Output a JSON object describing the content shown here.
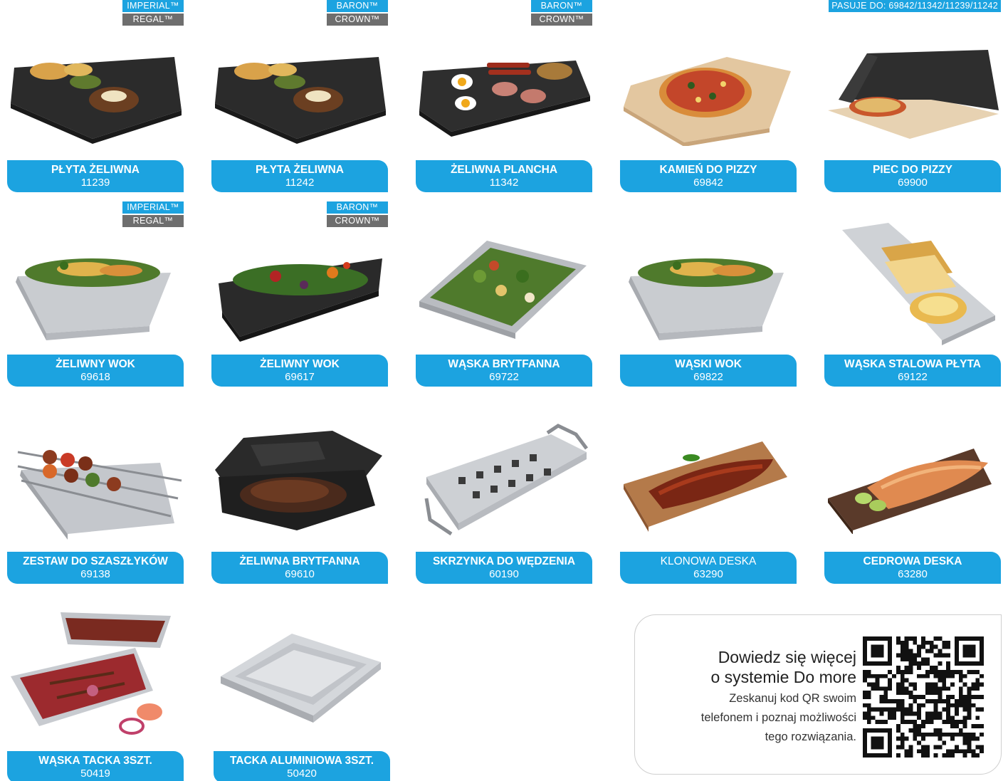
{
  "row1": [
    {
      "badges": [
        "IMPERIAL™",
        "REGAL™"
      ],
      "name": "PŁYTA ŻELIWNA",
      "code": "11239",
      "icon": "cast-iron-griddle-image"
    },
    {
      "badges": [
        "BARON™",
        "CROWN™"
      ],
      "name": "PŁYTA ŻELIWNA",
      "code": "11242",
      "icon": "cast-iron-griddle-image"
    },
    {
      "badges": [
        "BARON™",
        "CROWN™"
      ],
      "name": "ŻELIWNA PLANCHA",
      "code": "11342",
      "icon": "plancha-image"
    },
    {
      "badges": [],
      "name": "KAMIEŃ DO PIZZY",
      "code": "69842",
      "icon": "pizza-stone-image"
    },
    {
      "badges": [
        "PASUJE DO: 69842/11342/11239/11242"
      ],
      "name": "PIEC DO PIZZY",
      "code": "69900",
      "icon": "pizza-oven-image"
    }
  ],
  "row2": [
    {
      "badges": [
        "IMPERIAL™",
        "REGAL™"
      ],
      "name": "ŻELIWNY WOK",
      "code": "69618",
      "icon": "wok-image"
    },
    {
      "badges": [
        "BARON™",
        "CROWN™"
      ],
      "name": "ŻELIWNY WOK",
      "code": "69617",
      "icon": "cast-iron-wok-image"
    },
    {
      "badges": [],
      "name": "WĄSKA BRYTFANNA",
      "code": "69722",
      "icon": "narrow-roaster-image"
    },
    {
      "badges": [],
      "name": "WĄSKI WOK",
      "code": "69822",
      "icon": "narrow-wok-image"
    },
    {
      "badges": [],
      "name": "WĄSKA STALOWA PŁYTA",
      "code": "69122",
      "icon": "steel-plate-image"
    }
  ],
  "row3": [
    {
      "name": "ZESTAW DO SZASZŁYKÓW",
      "code": "69138",
      "icon": "skewer-set-image"
    },
    {
      "name": "ŻELIWNA BRYTFANNA",
      "code": "69610",
      "icon": "cast-iron-roaster-image"
    },
    {
      "name": "SKRZYNKA DO WĘDZENIA",
      "code": "60190",
      "icon": "smoker-box-image"
    },
    {
      "name": "KLONOWA DESKA",
      "code": "63290",
      "icon": "maple-plank-image"
    },
    {
      "name": "CEDROWA DESKA",
      "code": "63280",
      "icon": "cedar-plank-image"
    }
  ],
  "row4": [
    {
      "name": "WĄSKA TACKA 3SZT.",
      "code": "50419",
      "icon": "narrow-tray-image"
    },
    {
      "name": "TACKA ALUMINIOWA 3SZT.",
      "code": "50420",
      "icon": "aluminium-tray-image"
    }
  ],
  "info": {
    "line1": "Dowiedz się więcej",
    "line2": "o systemie Do more",
    "line3": "Zeskanuj kod QR swoim",
    "line4": "telefonem i poznaj możliwości",
    "line5": "tego rozwiązania.",
    "qr_icon": "qr-code-icon"
  },
  "colors": {
    "accent": "#1ca3e0",
    "badge_gray": "#6e6e6e"
  }
}
